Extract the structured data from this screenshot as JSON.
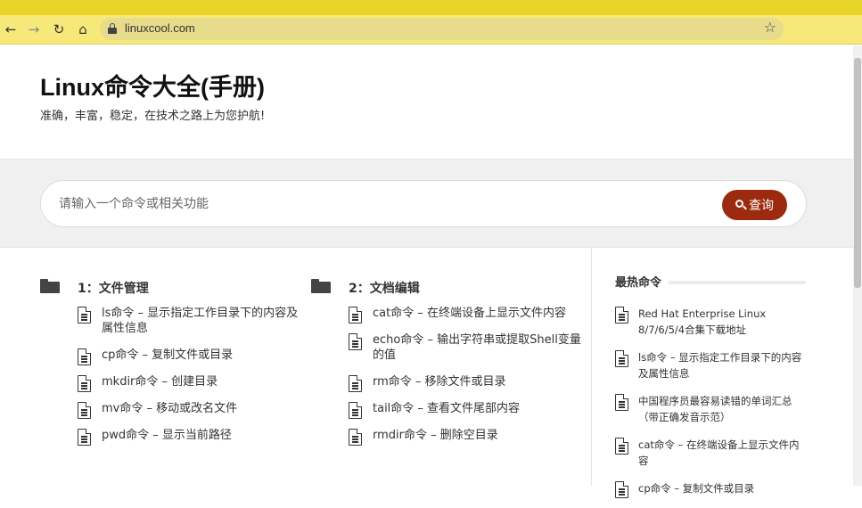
{
  "browser": {
    "url": "linuxcool.com",
    "back_icon": "←",
    "forward_icon": "→",
    "reload_icon": "↻",
    "home_icon": "⌂",
    "star_icon": "☆"
  },
  "site": {
    "title": "Linux命令大全(手册)",
    "tagline": "准确，丰富，稳定，在技术之路上为您护航!"
  },
  "search": {
    "placeholder": "请输入一个命令或相关功能",
    "button_label": "查询"
  },
  "categories": [
    {
      "title": "1：文件管理",
      "items": [
        "ls命令 – 显示指定工作目录下的内容及属性信息",
        "cp命令 – 复制文件或目录",
        "mkdir命令 – 创建目录",
        "mv命令 – 移动或改名文件",
        "pwd命令 – 显示当前路径"
      ]
    },
    {
      "title": "2：文档编辑",
      "items": [
        "cat命令 – 在终端设备上显示文件内容",
        "echo命令 – 输出字符串或提取Shell变量的值",
        "rm命令 – 移除文件或目录",
        "tail命令 – 查看文件尾部内容",
        "rmdir命令 – 删除空目录"
      ]
    }
  ],
  "sidebar": {
    "title": "最热命令",
    "items": [
      "Red Hat Enterprise Linux 8/7/6/5/4合集下载地址",
      "ls命令 – 显示指定工作目录下的内容及属性信息",
      "中国程序员最容易读错的单词汇总（带正确发音示范）",
      "cat命令 – 在终端设备上显示文件内容",
      "cp命令 – 复制文件或目录"
    ]
  }
}
